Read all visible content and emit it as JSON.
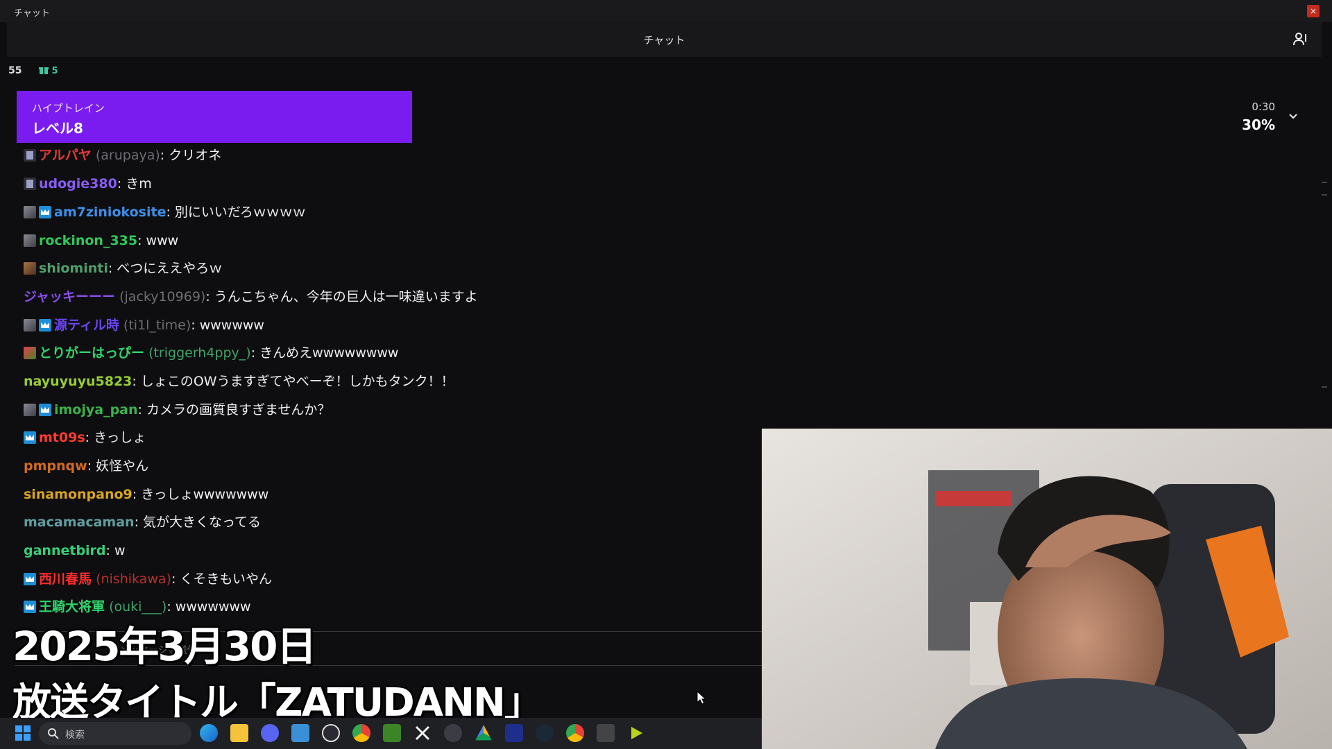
{
  "window": {
    "title": "チャット",
    "close_label": "×"
  },
  "header": {
    "title": "チャット"
  },
  "stats": {
    "viewer_count": "55",
    "gift_count": "5"
  },
  "hype_train": {
    "label": "ハイプトレイン",
    "level": "レベル8",
    "timer": "0:30",
    "progress": "30%"
  },
  "messages": [
    {
      "name": "アルパヤ",
      "login": "(arupaya)",
      "text": ": クリオネ",
      "name_color": "#e23a3a"
    },
    {
      "name": "udogie380",
      "login": "",
      "text": ": きm",
      "name_color": "#8a5cf5"
    },
    {
      "name": "am7ziniokosite",
      "login": "",
      "text": ": 別にいいだろｗｗｗｗ",
      "name_color": "#3c8fe8"
    },
    {
      "name": "rockinon_335",
      "login": "",
      "text": ": www",
      "name_color": "#2ec95a"
    },
    {
      "name": "shiominti",
      "login": "",
      "text": ": べつにええやろｗ",
      "name_color": "#4fa06a"
    },
    {
      "name": "ジャッキーーー",
      "login": "(jacky10969)",
      "text": ": うんこちゃん、今年の巨人は一味違いますよ",
      "name_color": "#8a4df0"
    },
    {
      "name": "源ティル時",
      "login": "(ti1l_time)",
      "text": ": wwwwww",
      "name_color": "#6b45f0"
    },
    {
      "name": "とりがーはっぴー",
      "login": "(triggerh4ppy_)",
      "text": ": きんめえwwwwwwww",
      "name_color": "#2fd46a"
    },
    {
      "name": "nayuyuyu5823",
      "login": "",
      "text": ": しょこのOWうますぎてやべーぞ！しかもタンク！！",
      "name_color": "#9acd32"
    },
    {
      "name": "imojya_pan",
      "login": "",
      "text": ": カメラの画質良すぎませんか？",
      "name_color": "#3ab54a"
    },
    {
      "name": "mt09s",
      "login": "",
      "text": ": きっしょ",
      "name_color": "#ff3b2f"
    },
    {
      "name": "pmpnqw",
      "login": "",
      "text": ": 妖怪やん",
      "name_color": "#d2691e"
    },
    {
      "name": "sinamonpano9",
      "login": "",
      "text": ": きっしょwwwwwww",
      "name_color": "#daa520"
    },
    {
      "name": "macamacaman",
      "login": "",
      "text": ": 気が大きくなってる",
      "name_color": "#5f9ea0"
    },
    {
      "name": "gannetbird",
      "login": "",
      "text": ": w",
      "name_color": "#33d17a"
    },
    {
      "name": "西川春馬",
      "login": "(nishikawa)",
      "text": ": くそきもいやん",
      "name_color": "#ff2d2d"
    },
    {
      "name": "王騎大将軍",
      "login": "(ouki___)",
      "text": ": wwwwwww",
      "name_color": "#2fd46a"
    }
  ],
  "chat_input": {
    "placeholder": "メッセージを送信"
  },
  "captions": {
    "date": "2025年3月30日",
    "title": "放送タイトル「ZATUDANN」"
  },
  "taskbar": {
    "search_placeholder": "検索"
  },
  "icons": [
    "windows-icon",
    "search-icon",
    "edge-icon",
    "folder-icon",
    "discord-icon",
    "notes-icon",
    "obs-icon",
    "chrome-icon",
    "minecraft-icon",
    "capcut-icon",
    "keyboard-icon",
    "drive-icon",
    "monitor-icon",
    "steam-icon",
    "chrome-icon",
    "app-icon",
    "media-icon"
  ]
}
